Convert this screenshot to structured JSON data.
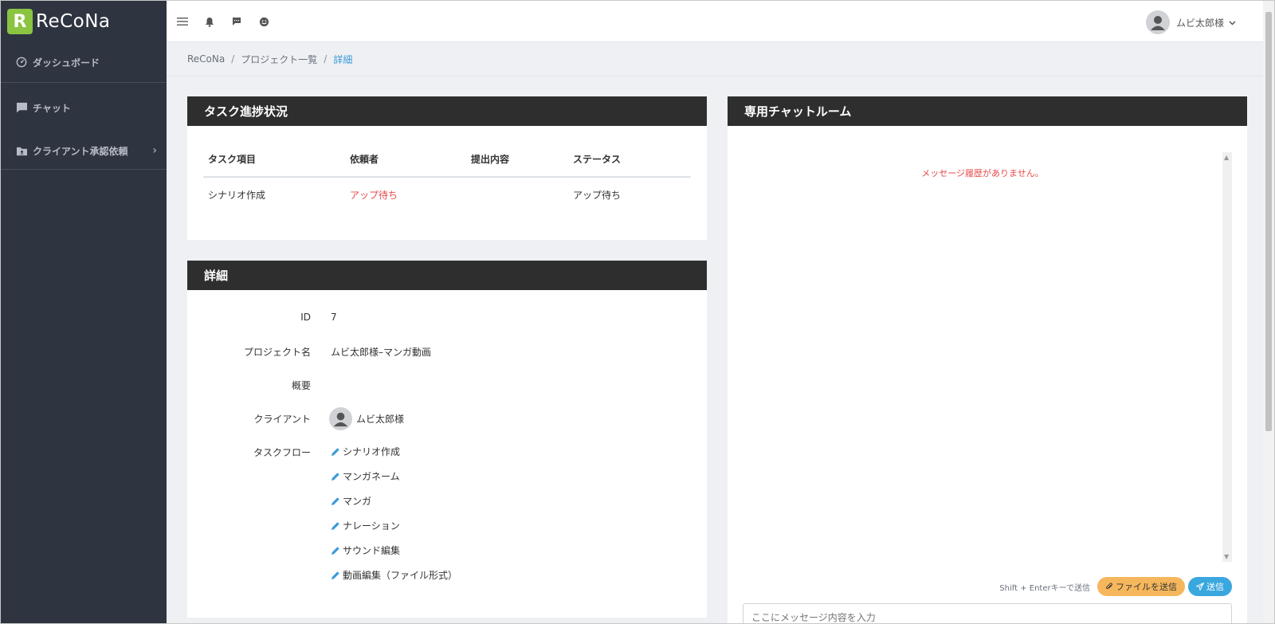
{
  "sidebar": {
    "logo_mark": "R",
    "logo_text": "ReCoNa",
    "items": [
      {
        "label": "ダッシュボード"
      },
      {
        "label": "チャット"
      },
      {
        "label": "クライアント承認依頼"
      }
    ]
  },
  "topbar": {
    "user_name": "ムビ太郎様"
  },
  "breadcrumb": {
    "items": [
      "ReCoNa",
      "プロジェクト一覧",
      "詳細"
    ]
  },
  "task_card": {
    "title": "タスク進捗状況",
    "columns": [
      "タスク項目",
      "依頼者",
      "提出内容",
      "ステータス"
    ],
    "rows": [
      {
        "item": "シナリオ作成",
        "requester": "アップ待ち",
        "submission": "",
        "status": "アップ待ち"
      }
    ]
  },
  "detail_card": {
    "title": "詳細",
    "id_label": "ID",
    "id_value": "7",
    "project_label": "プロジェクト名",
    "project_value": "ムビ太郎様–マンガ動画",
    "summary_label": "概要",
    "summary_value": "",
    "client_label": "クライアント",
    "client_value": "ムビ太郎様",
    "flow_label": "タスクフロー",
    "flow": [
      "シナリオ作成",
      "マンガネーム",
      "マンガ",
      "ナレーション",
      "サウンド編集",
      "動画編集（ファイル形式）"
    ]
  },
  "chat_card": {
    "title": "専用チャットルーム",
    "empty_message": "メッセージ履歴がありません。",
    "hint": "Shift + Enterキーで送信",
    "file_button": "ファイルを送信",
    "send_button": "送信",
    "input_placeholder": "ここにメッセージ内容を入力"
  },
  "colors": {
    "sidebar_bg": "#2f3441",
    "logo_green": "#8ac441",
    "card_header": "#2e2e2e",
    "accent_blue": "#3a9bd9",
    "alert_red": "#e84a4a",
    "file_button": "#f6b75c",
    "send_button": "#3aa7df"
  },
  "icons": [
    "menu-icon",
    "bell-icon",
    "comment-icon",
    "smile-icon",
    "dashboard-icon",
    "chat-icon",
    "folder-icon",
    "pencil-icon",
    "paperclip-icon",
    "paper-plane-icon",
    "user-icon"
  ]
}
